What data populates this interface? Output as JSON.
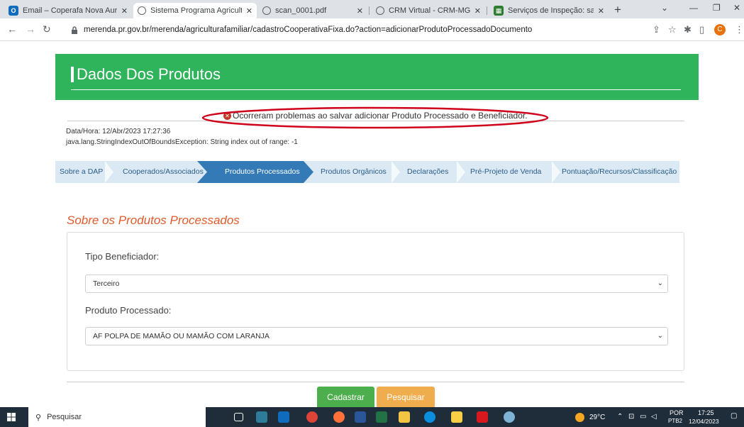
{
  "browser": {
    "tabs": [
      {
        "title": "Email – Coperafa Nova Auror",
        "favicon": "outlook-icon",
        "color": "#0f6cbd"
      },
      {
        "title": "Sistema Programa Agricultur",
        "favicon": "globe-icon",
        "color": "#5f6368",
        "active": true
      },
      {
        "title": "scan_0001.pdf",
        "favicon": "globe-icon",
        "color": "#5f6368"
      },
      {
        "title": "CRM Virtual - CRM-MG, Cert",
        "favicon": "globe-icon",
        "color": "#5f6368"
      },
      {
        "title": "Serviços de Inspeção: saiba r",
        "favicon": "gov-icon",
        "color": "#2e7d32"
      }
    ],
    "url": "merenda.pr.gov.br/merenda/agriculturafamiliar/cadastroCooperativaFixa.do?action=adicionarProdutoProcessadoDocumento",
    "profile_initial": "C"
  },
  "page": {
    "title": "Dados Dos Produtos",
    "error": {
      "message": "Ocorreram problemas ao salvar adicionar Produto Processado e Beneficiador.",
      "datetime": "Data/Hora: 12/Abr/2023 17:27:36",
      "exception": "java.lang.StringIndexOutOfBoundsException: String index out of range: -1"
    },
    "steps": [
      "Sobre a DAP",
      "Cooperados/Associados",
      "Produtos Processados",
      "Produtos Orgânicos",
      "Declarações",
      "Pré-Projeto de Venda",
      "Pontuação/Recursos/Classificação"
    ],
    "active_step": "Produtos Processados",
    "section_title": "Sobre os Produtos Processados",
    "form": {
      "tipo_label": "Tipo Beneficiador:",
      "tipo_value": "Terceiro",
      "produto_label": "Produto Processado:",
      "produto_value": "AF POLPA DE MAMÃO OU MAMÃO COM LARANJA"
    },
    "buttons": {
      "cadastrar": "Cadastrar",
      "pesquisar": "Pesquisar"
    }
  },
  "taskbar": {
    "search_placeholder": "Pesquisar",
    "temperature": "29°C",
    "language": "POR",
    "layout": "PTB2",
    "time": "17:25",
    "date": "12/04/2023"
  },
  "colors": {
    "banner": "#2fb35b",
    "step_active": "#337ab7",
    "step_bg": "#dbe9f5",
    "section_title": "#e05a2b",
    "btn_green": "#4cae4c",
    "btn_orange": "#f0ad4e",
    "annotation_ellipse": "#d0021b"
  }
}
